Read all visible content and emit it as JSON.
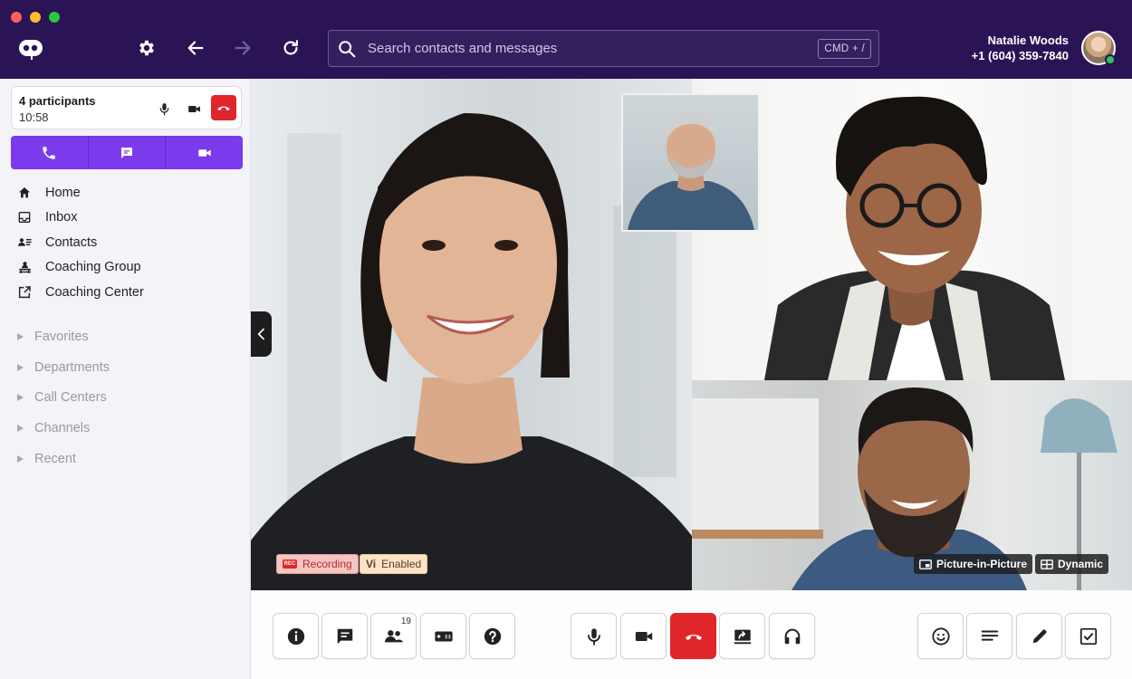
{
  "window": {
    "traffic_lights": [
      "close",
      "minimize",
      "zoom"
    ]
  },
  "toolbar": {
    "logo_icon": "dialpad-logo-icon",
    "settings_icon": "gear-icon",
    "back_icon": "arrow-left-icon",
    "forward_icon": "arrow-right-icon",
    "reload_icon": "reload-icon"
  },
  "search": {
    "placeholder": "Search contacts and messages",
    "shortcut": "CMD + /"
  },
  "user": {
    "name": "Natalie Woods",
    "phone": "+1 (604) 359-7840",
    "status": "online"
  },
  "call_card": {
    "participants": "4 participants",
    "duration": "10:58"
  },
  "nav": {
    "items": [
      {
        "label": "Home",
        "icon": "home-icon"
      },
      {
        "label": "Inbox",
        "icon": "inbox-icon"
      },
      {
        "label": "Contacts",
        "icon": "contacts-icon"
      },
      {
        "label": "Coaching Group",
        "icon": "coaching-group-icon"
      },
      {
        "label": "Coaching Center",
        "icon": "external-link-icon"
      }
    ],
    "groups": [
      "Favorites",
      "Departments",
      "Call Centers",
      "Channels",
      "Recent"
    ]
  },
  "video": {
    "recording_label": "Recording",
    "recording_icon_text": "REC",
    "vi_mark": "Vi",
    "vi_label": "Enabled",
    "pip_label": "Picture-in-Picture",
    "dynamic_label": "Dynamic"
  },
  "controls": {
    "participants_count": "19",
    "left": [
      "info-icon",
      "chat-icon",
      "participants-icon",
      "tickets-icon",
      "help-icon"
    ],
    "center": [
      "microphone-icon",
      "camera-icon",
      "hangup-icon",
      "screen-share-icon",
      "headset-icon"
    ],
    "right": [
      "emoji-icon",
      "notes-icon",
      "edit-icon",
      "checklist-icon"
    ]
  },
  "colors": {
    "titlebar": "#2a1456",
    "accent": "#7c3aed",
    "hangup": "#e0252b",
    "presence": "#2dc653"
  }
}
